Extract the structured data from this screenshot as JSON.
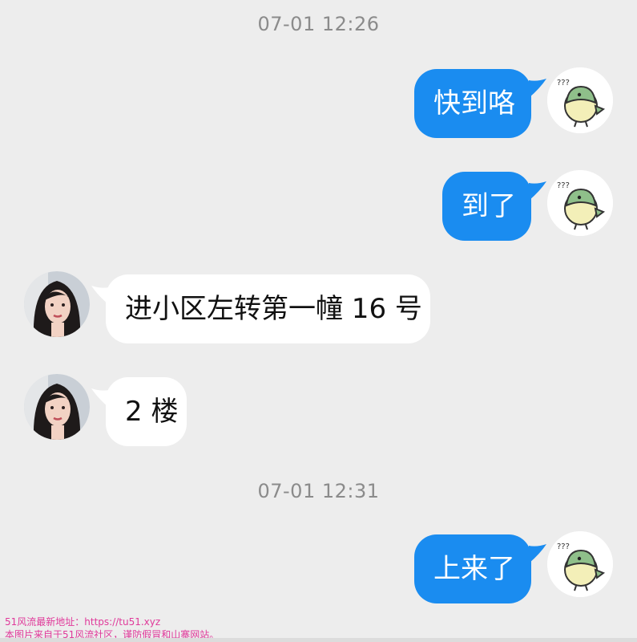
{
  "timestamps": [
    "07-01 12:26",
    "07-01 12:31"
  ],
  "messages": [
    {
      "sender": "me",
      "text": "快到咯"
    },
    {
      "sender": "me",
      "text": "到了"
    },
    {
      "sender": "contact",
      "text": "进小区左转第一幢 16 号"
    },
    {
      "sender": "contact",
      "text": "2 楼"
    },
    {
      "sender": "me",
      "text": "上来了"
    }
  ],
  "avatars": {
    "me": "bird-avatar-icon",
    "contact": "woman-avatar-icon"
  },
  "watermark": {
    "line1": "51风流最新地址：https://tu51.xyz",
    "line2": "本图片来自于51风流社区，谨防假冒和山寨网站。"
  },
  "colors": {
    "outgoing_bubble": "#1a8cf0",
    "incoming_bubble": "#ffffff",
    "background": "#ededed",
    "watermark": "#e0399a"
  }
}
